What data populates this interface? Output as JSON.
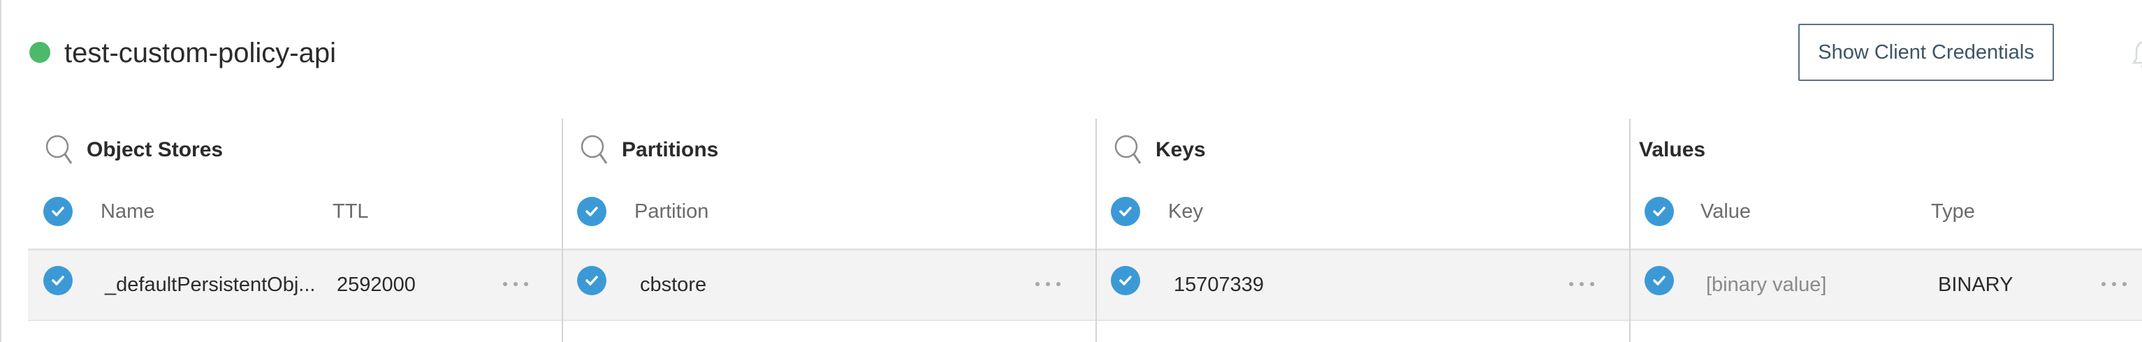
{
  "header": {
    "api_name": "test-custom-policy-api",
    "status_color": "#4cba6a",
    "show_credentials_label": "Show Client Credentials"
  },
  "panels": {
    "object_stores": {
      "title": "Object Stores",
      "columns": [
        "Name",
        "TTL"
      ],
      "rows": [
        {
          "name": "_defaultPersistentObj...",
          "ttl": "2592000"
        }
      ]
    },
    "partitions": {
      "title": "Partitions",
      "columns": [
        "Partition"
      ],
      "rows": [
        {
          "partition": "cbstore"
        }
      ]
    },
    "keys": {
      "title": "Keys",
      "columns": [
        "Key"
      ],
      "rows": [
        {
          "key": "15707339"
        }
      ]
    },
    "values": {
      "title": "Values",
      "columns": [
        "Value",
        "Type"
      ],
      "rows": [
        {
          "value": "[binary value]",
          "type": "BINARY"
        }
      ]
    }
  },
  "icons": {
    "search": "search-icon",
    "check": "check-circle-icon",
    "more": "more-horizontal-icon",
    "bell": "bell-icon"
  },
  "colors": {
    "accent": "#3b9ad6",
    "button_border": "#5a7184",
    "divider": "#d4d4d4",
    "row_bg": "#f3f3f3"
  }
}
